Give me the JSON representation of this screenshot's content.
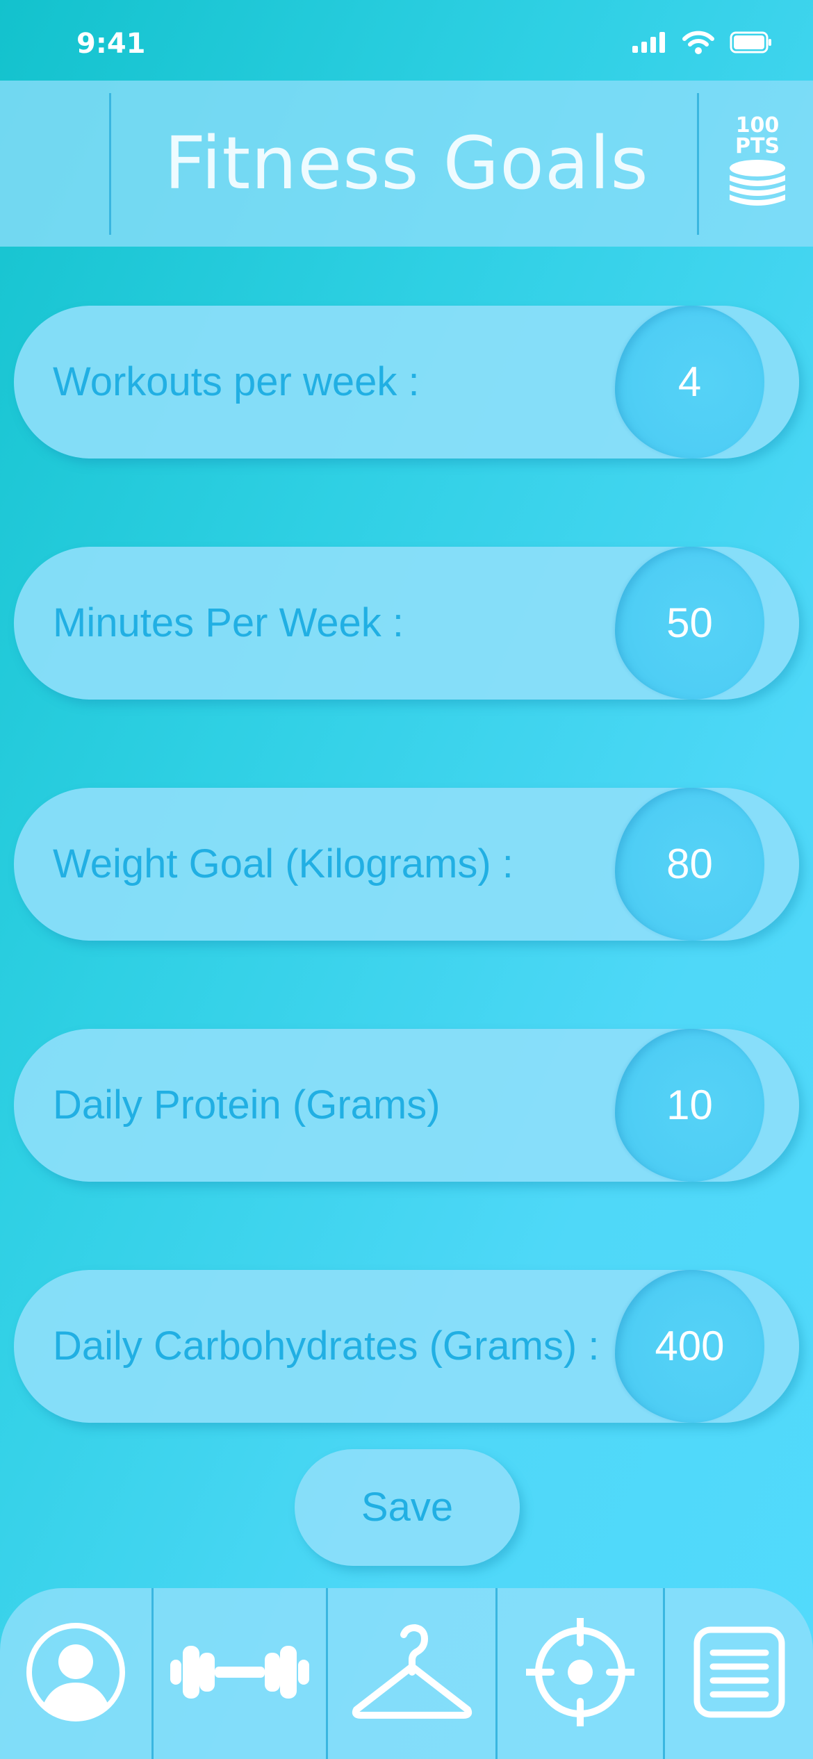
{
  "status_bar": {
    "time": "9:41",
    "icons": [
      "cellular-signal-icon",
      "wifi-icon",
      "battery-icon"
    ]
  },
  "header": {
    "title": "Fitness Goals",
    "points_value": "100",
    "points_unit": "PTS",
    "points_icon": "coin-stack-icon"
  },
  "goals": [
    {
      "label": "Workouts per week :",
      "value": "4"
    },
    {
      "label": "Minutes Per Week :",
      "value": "50"
    },
    {
      "label": "Weight Goal (Kilograms) :",
      "value": "80"
    },
    {
      "label": "Daily Protein (Grams)",
      "value": "10"
    },
    {
      "label": "Daily Carbohydrates (Grams) :",
      "value": "400"
    }
  ],
  "save_button": {
    "label": "Save"
  },
  "bottom_nav": {
    "items": [
      "profile-icon",
      "dumbbell-icon",
      "hanger-icon",
      "target-icon",
      "list-icon"
    ]
  },
  "colors": {
    "background_start": "#13c2cd",
    "background_end": "#52dafc",
    "pill": "#8cdefa",
    "label_text": "#21afe3",
    "value_blob": "#4fcef5",
    "divider": "#3ab6e0"
  }
}
